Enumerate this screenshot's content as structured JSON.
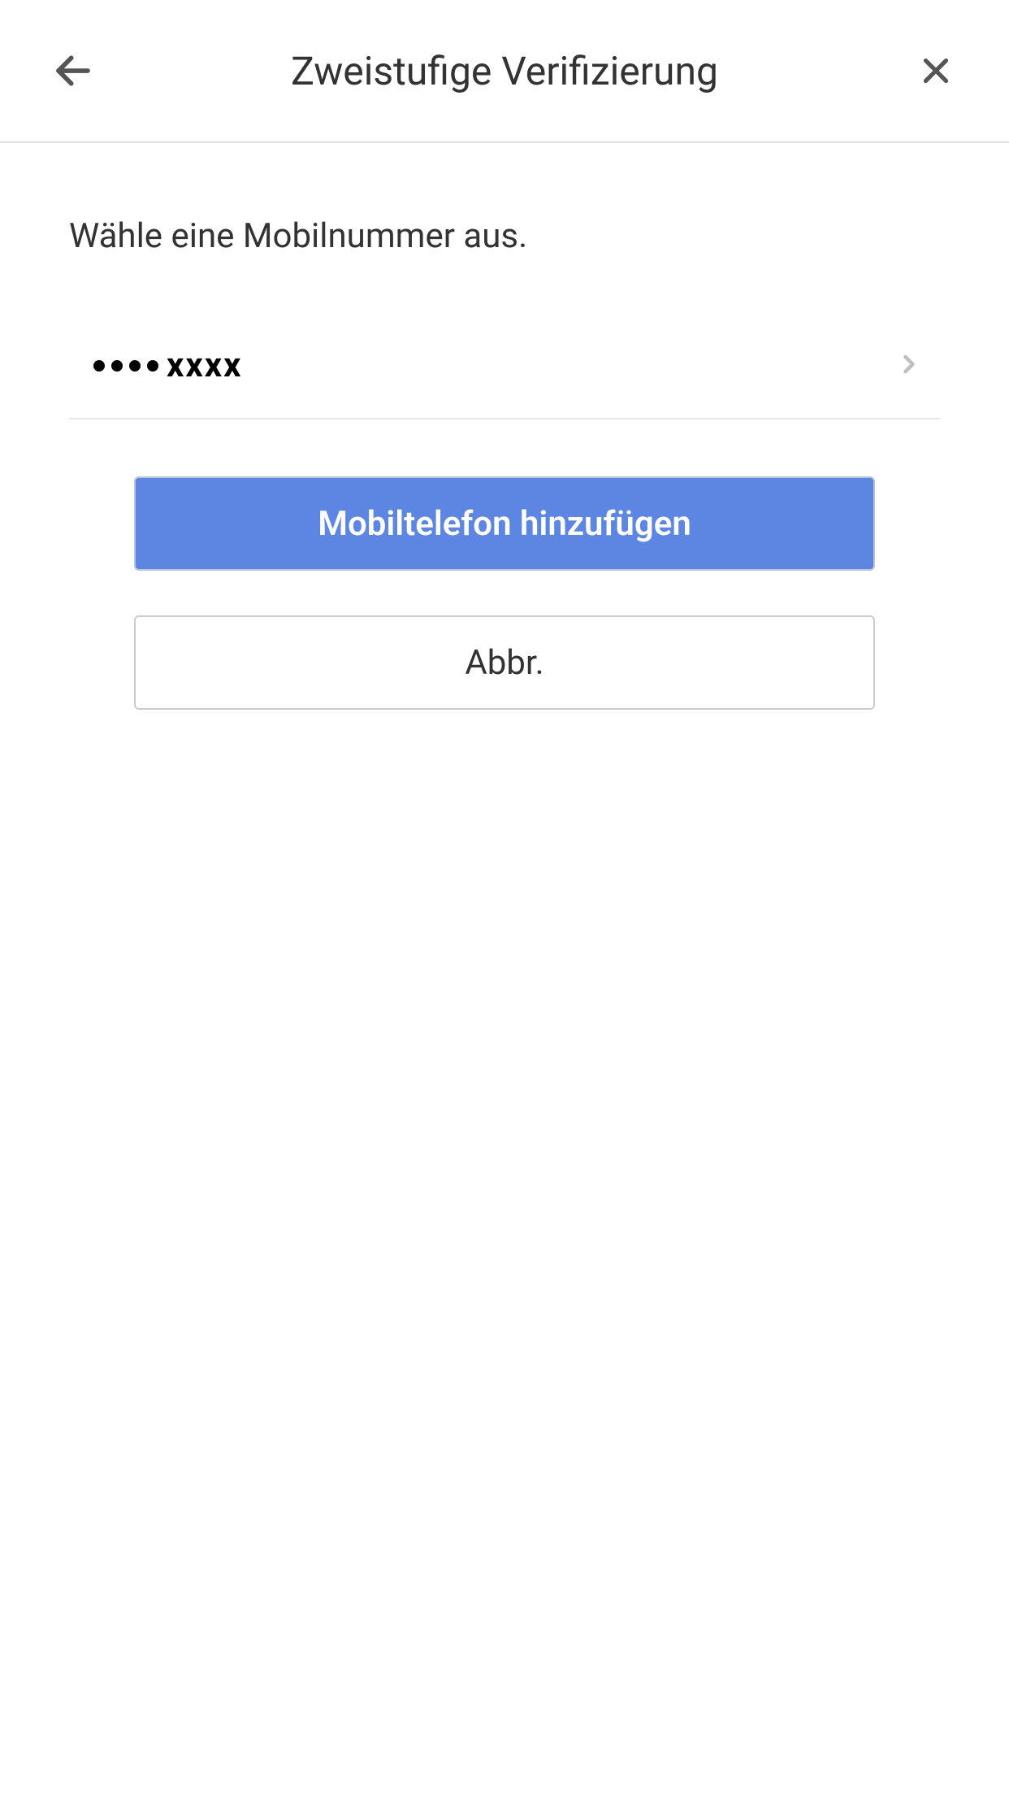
{
  "header": {
    "title": "Zweistufige Verifizierung"
  },
  "content": {
    "instruction": "Wähle eine Mobilnummer aus.",
    "phone_label": "xxxx"
  },
  "buttons": {
    "add_phone": "Mobiltelefon hinzufügen",
    "cancel": "Abbr."
  }
}
